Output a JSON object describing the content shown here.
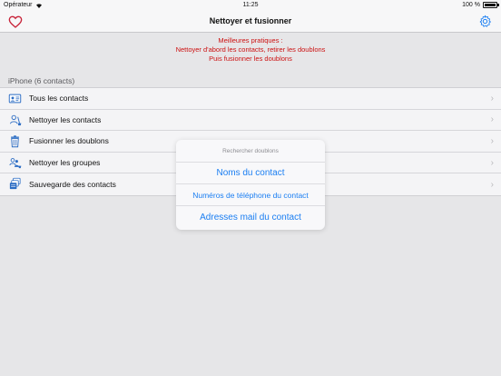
{
  "status_bar": {
    "carrier": "Opérateur",
    "time": "11:25",
    "battery_pct": "100 %"
  },
  "nav": {
    "title": "Nettoyer et fusionner"
  },
  "tips": {
    "line1": "Meilleures pratiques :",
    "line2": "Nettoyer d'abord les contacts, retirer les doublons",
    "line3": "Puis fusionner les doublons"
  },
  "section": {
    "header": "iPhone (6 contacts)"
  },
  "menu": {
    "items": [
      {
        "label": "Tous les contacts",
        "icon": "contact-card-icon"
      },
      {
        "label": "Nettoyer les contacts",
        "icon": "broom-person-icon"
      },
      {
        "label": "Fusionner les doublons",
        "icon": "trash-icon"
      },
      {
        "label": "Nettoyer les groupes",
        "icon": "group-icon"
      },
      {
        "label": "Sauvegarde des contacts",
        "icon": "backup-stack-icon"
      }
    ]
  },
  "popup": {
    "title": "Rechercher doublons",
    "options": [
      "Noms du contact",
      "Numéros de téléphone du contact",
      "Adresses mail du contact"
    ]
  },
  "colors": {
    "accent": "#1a7ef2",
    "tips_red": "#cc1111",
    "heart": "#c8243a"
  }
}
